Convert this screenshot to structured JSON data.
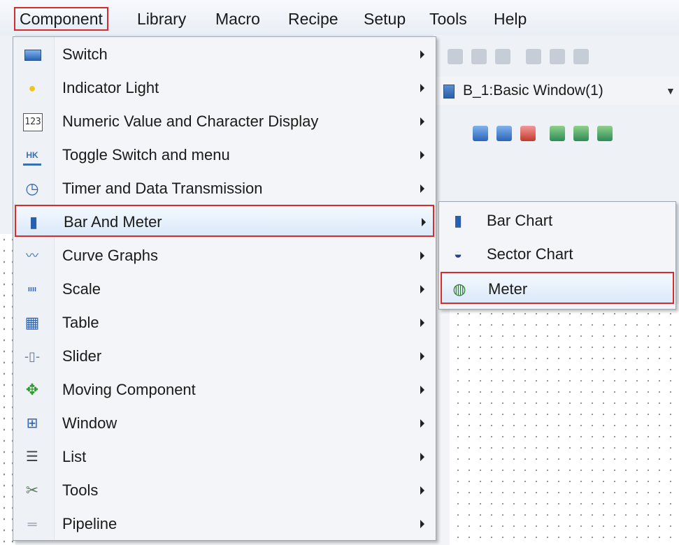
{
  "menubar": {
    "items": [
      {
        "label": "Component",
        "active": true
      },
      {
        "label": "Library"
      },
      {
        "label": "Macro"
      },
      {
        "label": "Recipe"
      },
      {
        "label": "Setup"
      },
      {
        "label": "Tools"
      },
      {
        "label": "Help"
      }
    ]
  },
  "window_selector": {
    "label": "B_1:Basic Window(1)"
  },
  "component_menu": {
    "items": [
      {
        "label": "Switch",
        "icon": "switch-icon"
      },
      {
        "label": "Indicator Light",
        "icon": "lightbulb-icon"
      },
      {
        "label": "Numeric Value and Character Display",
        "icon": "numeric-display-icon"
      },
      {
        "label": "Toggle Switch and menu",
        "icon": "toggle-switch-icon"
      },
      {
        "label": "Timer and Data Transmission",
        "icon": "clock-icon"
      },
      {
        "label": "Bar And Meter",
        "icon": "bar-meter-icon",
        "highlighted": true
      },
      {
        "label": "Curve Graphs",
        "icon": "curve-graph-icon"
      },
      {
        "label": "Scale",
        "icon": "scale-icon"
      },
      {
        "label": "Table",
        "icon": "table-icon"
      },
      {
        "label": "Slider",
        "icon": "slider-icon"
      },
      {
        "label": "Moving Component",
        "icon": "move-arrows-icon"
      },
      {
        "label": "Window",
        "icon": "window-icon"
      },
      {
        "label": "List",
        "icon": "list-icon"
      },
      {
        "label": "Tools",
        "icon": "tools-icon"
      },
      {
        "label": "Pipeline",
        "icon": "pipeline-icon"
      }
    ]
  },
  "bar_meter_submenu": {
    "items": [
      {
        "label": "Bar Chart",
        "icon": "bar-chart-icon"
      },
      {
        "label": "Sector Chart",
        "icon": "sector-chart-icon"
      },
      {
        "label": "Meter",
        "icon": "meter-icon",
        "highlighted": true
      }
    ]
  },
  "colors": {
    "highlight_border": "#d92b2b",
    "menu_bg": "#f3f5f8",
    "hover_bg": "#dbe9f9"
  }
}
